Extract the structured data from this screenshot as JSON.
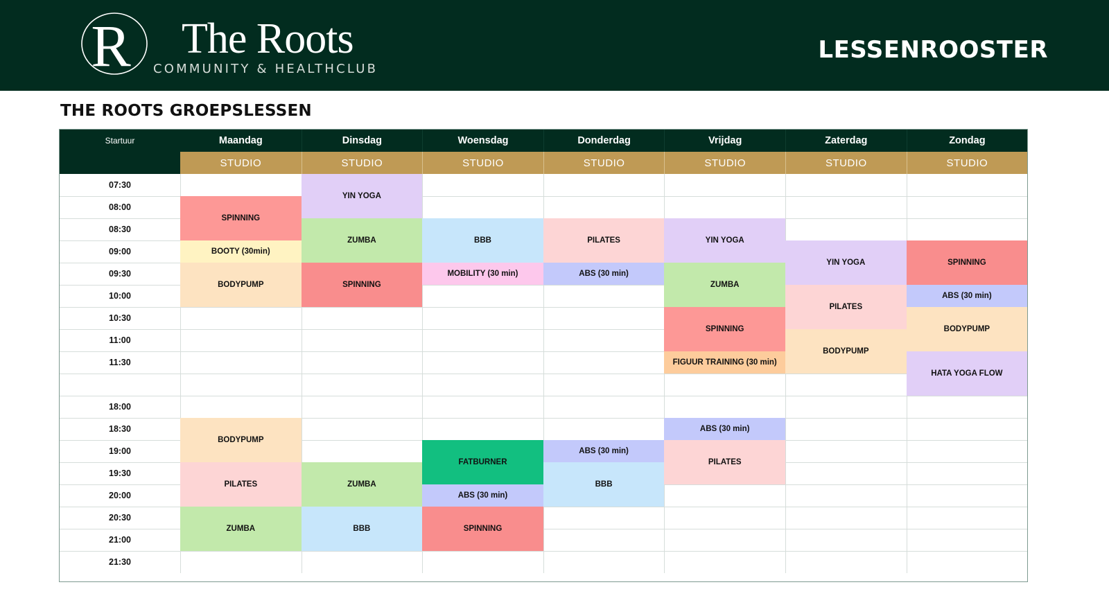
{
  "header": {
    "logo_letter": "R",
    "brand_name": "The Roots",
    "brand_tagline": "COMMUNITY & HEALTHCLUB",
    "page_label": "LESSENROOSTER",
    "background": "#022c1f"
  },
  "section_title": "THE ROOTS GROEPSLESSEN",
  "table": {
    "start_header": "Startuur",
    "days": [
      "Maandag",
      "Dinsdag",
      "Woensdag",
      "Donderdag",
      "Vrijdag",
      "Zaterdag",
      "Zondag"
    ],
    "studio_label": "STUDIO",
    "times": [
      "07:30",
      "08:00",
      "08:30",
      "09:00",
      "09:30",
      "10:00",
      "10:30",
      "11:00",
      "11:30",
      "",
      "18:00",
      "18:30",
      "19:00",
      "19:30",
      "20:00",
      "20:30",
      "21:00",
      "21:30"
    ],
    "classes": [
      {
        "day": 0,
        "start": 1,
        "span": 2,
        "name": "SPINNING",
        "color": "#fd9896"
      },
      {
        "day": 0,
        "start": 3,
        "span": 1,
        "name": "BOOTY (30min)",
        "color": "#fff3c2"
      },
      {
        "day": 0,
        "start": 4,
        "span": 2,
        "name": "BODYPUMP",
        "color": "#fde3c1"
      },
      {
        "day": 0,
        "start": 11,
        "span": 2,
        "name": "BODYPUMP",
        "color": "#fde3c1"
      },
      {
        "day": 0,
        "start": 13,
        "span": 2,
        "name": "PILATES",
        "color": "#fdd5d5"
      },
      {
        "day": 0,
        "start": 15,
        "span": 2,
        "name": "ZUMBA",
        "color": "#c2e9ab"
      },
      {
        "day": 1,
        "start": 0,
        "span": 2,
        "name": "YIN YOGA",
        "color": "#e1cff7"
      },
      {
        "day": 1,
        "start": 2,
        "span": 2,
        "name": "ZUMBA",
        "color": "#c2e9ab"
      },
      {
        "day": 1,
        "start": 4,
        "span": 2,
        "name": "SPINNING",
        "color": "#f98d8d"
      },
      {
        "day": 1,
        "start": 13,
        "span": 2,
        "name": "ZUMBA",
        "color": "#c2e9ab"
      },
      {
        "day": 1,
        "start": 15,
        "span": 2,
        "name": "BBB",
        "color": "#c7e6fb"
      },
      {
        "day": 2,
        "start": 2,
        "span": 2,
        "name": "BBB",
        "color": "#c7e6fb"
      },
      {
        "day": 2,
        "start": 4,
        "span": 1,
        "name": "MOBILITY  (30 min)",
        "color": "#fdc8ec"
      },
      {
        "day": 2,
        "start": 12,
        "span": 2,
        "name": "FATBURNER",
        "color": "#12bf80"
      },
      {
        "day": 2,
        "start": 14,
        "span": 1,
        "name": "ABS (30 min)",
        "color": "#c3c9fb"
      },
      {
        "day": 2,
        "start": 15,
        "span": 2,
        "name": "SPINNING",
        "color": "#f98d8d"
      },
      {
        "day": 3,
        "start": 2,
        "span": 2,
        "name": "PILATES",
        "color": "#fdd5d5"
      },
      {
        "day": 3,
        "start": 4,
        "span": 1,
        "name": "ABS (30 min)",
        "color": "#c3c9fb"
      },
      {
        "day": 3,
        "start": 12,
        "span": 1,
        "name": "ABS (30 min)",
        "color": "#c3c9fb"
      },
      {
        "day": 3,
        "start": 13,
        "span": 2,
        "name": "BBB",
        "color": "#c7e6fb"
      },
      {
        "day": 4,
        "start": 2,
        "span": 2,
        "name": "YIN YOGA",
        "color": "#e1cff7"
      },
      {
        "day": 4,
        "start": 4,
        "span": 2,
        "name": "ZUMBA",
        "color": "#c2e9ab"
      },
      {
        "day": 4,
        "start": 6,
        "span": 2,
        "name": "SPINNING",
        "color": "#fd9896"
      },
      {
        "day": 4,
        "start": 8,
        "span": 1,
        "name": "FIGUUR TRAINING (30 min)",
        "color": "#fdcc9c"
      },
      {
        "day": 4,
        "start": 11,
        "span": 1,
        "name": "ABS (30 min)",
        "color": "#c3c9fb"
      },
      {
        "day": 4,
        "start": 12,
        "span": 2,
        "name": "PILATES",
        "color": "#fdd5d5"
      },
      {
        "day": 5,
        "start": 3,
        "span": 2,
        "name": "YIN YOGA",
        "color": "#e1cff7"
      },
      {
        "day": 5,
        "start": 5,
        "span": 2,
        "name": "PILATES",
        "color": "#fdd5d5"
      },
      {
        "day": 5,
        "start": 7,
        "span": 2,
        "name": "BODYPUMP",
        "color": "#fde3c1"
      },
      {
        "day": 6,
        "start": 3,
        "span": 2,
        "name": "SPINNING",
        "color": "#f98d8d"
      },
      {
        "day": 6,
        "start": 5,
        "span": 1,
        "name": "ABS (30 min)",
        "color": "#c3c9fb"
      },
      {
        "day": 6,
        "start": 6,
        "span": 2,
        "name": "BODYPUMP",
        "color": "#fde3c1"
      },
      {
        "day": 6,
        "start": 8,
        "span": 2,
        "name": "HATA YOGA FLOW",
        "color": "#e1cff7"
      }
    ]
  },
  "colors": {
    "dark_green": "#022c1f",
    "gold": "#bf9a55",
    "grid_line": "#d6ddda"
  }
}
